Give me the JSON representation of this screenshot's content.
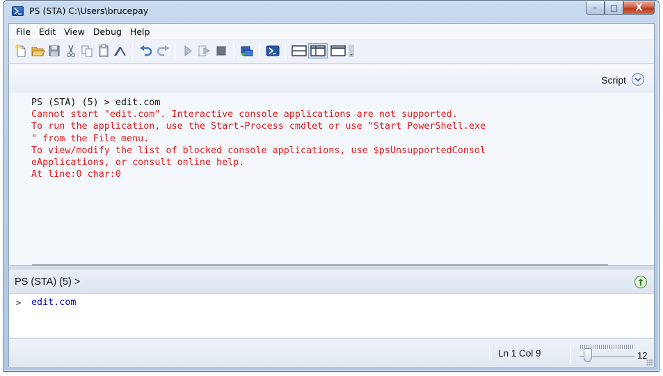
{
  "window": {
    "title": "PS (STA)  C:\\Users\\brucepay",
    "minimize_glyph": "–",
    "maximize_glyph": "□",
    "close_glyph": "X"
  },
  "menu": {
    "items": [
      "File",
      "Edit",
      "View",
      "Debug",
      "Help"
    ]
  },
  "toolbar": {
    "icons": [
      "new-file-icon",
      "open-folder-icon",
      "save-icon",
      "cut-icon",
      "copy-icon",
      "paste-icon",
      "clear-icon",
      "undo-icon",
      "redo-icon",
      "run-icon",
      "run-selection-icon",
      "stop-icon",
      "new-remote-tab-icon",
      "start-powershell-icon",
      "show-script-top-icon",
      "show-script-right-icon",
      "hide-script-icon",
      "more-icon"
    ]
  },
  "output_pane": {
    "script_label": "Script",
    "command_line": "PS (STA) (5) > edit.com",
    "error_lines": [
      "Cannot start \"edit.com\". Interactive console applications are not supported.",
      "To run the application, use the Start-Process cmdlet or use \"Start PowerShell.exe",
      "\" from the File menu.",
      "To view/modify the list of blocked console applications, use $psUnsupportedConsol",
      "eApplications, or consult online help.",
      "At line:0 char:0"
    ]
  },
  "command_pane": {
    "prompt": "PS (STA) (5) >",
    "prompt_char": ">",
    "input_value": "edit.com"
  },
  "status": {
    "position": "Ln 1  Col 9",
    "zoom": "12",
    "zoom_level_fraction": 0.15
  },
  "colors": {
    "error": "#e31b1b",
    "command_input": "#0a0ad8"
  }
}
